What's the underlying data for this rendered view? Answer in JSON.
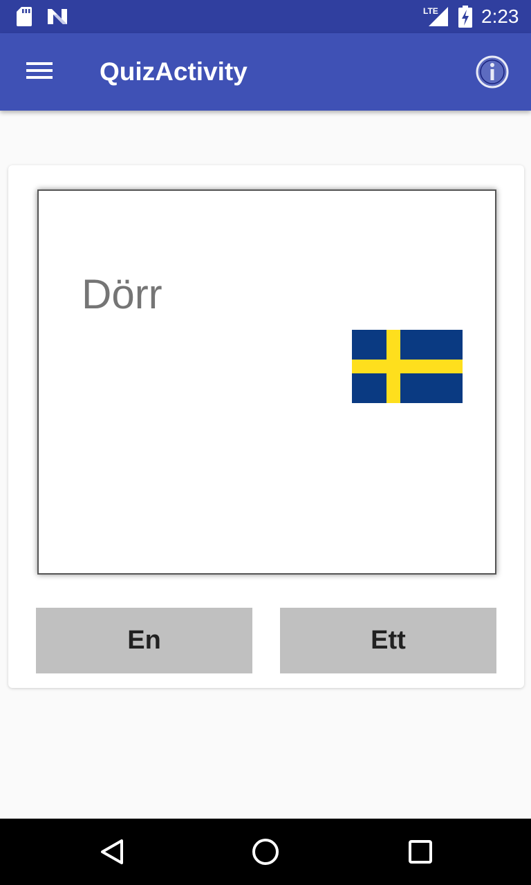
{
  "status_bar": {
    "time": "2:23",
    "network": "LTE",
    "icons": [
      "sd-card-icon",
      "n-notification-icon",
      "lte-signal-icon",
      "battery-charging-icon"
    ]
  },
  "app_bar": {
    "title": "QuizActivity",
    "menu_icon": "hamburger-menu-icon",
    "info_icon": "info-icon",
    "background_color": "#3f51b5",
    "status_color": "#303f9f"
  },
  "quiz": {
    "word": "Dörr",
    "flag_icon": "swedish-flag-icon",
    "flag_colors": {
      "blue": "#0a3a82",
      "yellow": "#fedf1d"
    },
    "answers": [
      {
        "label": "En"
      },
      {
        "label": "Ett"
      }
    ]
  },
  "nav_bar": {
    "icons": [
      "back-icon",
      "home-icon",
      "recents-icon"
    ]
  }
}
